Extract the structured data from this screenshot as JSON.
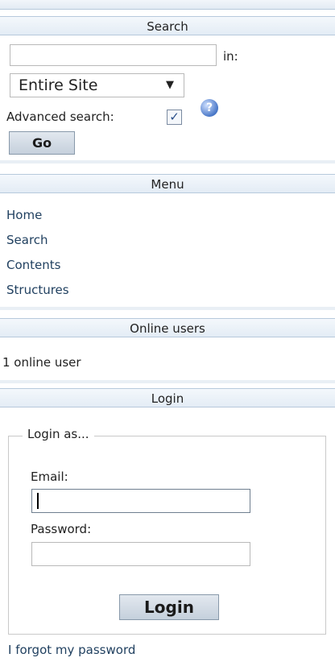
{
  "search": {
    "header": "Search",
    "query_value": "",
    "in_label": "in:",
    "scope_value": "Entire Site",
    "advanced_label": "Advanced search:",
    "advanced_checked": "✓",
    "help_glyph": "?",
    "go_label": "Go"
  },
  "menu": {
    "header": "Menu",
    "items": [
      {
        "label": "Home"
      },
      {
        "label": "Search"
      },
      {
        "label": "Contents"
      },
      {
        "label": "Structures"
      }
    ]
  },
  "online": {
    "header": "Online users",
    "status": "1 online user"
  },
  "login": {
    "header": "Login",
    "legend": "Login as...",
    "email_label": "Email:",
    "email_value": "",
    "password_label": "Password:",
    "password_value": "",
    "button_label": "Login",
    "forgot_link": "I forgot my password"
  },
  "colors": {
    "header_bg": "#e3ecf5",
    "header_border": "#b7c9dc",
    "link": "#1f3f5f"
  }
}
